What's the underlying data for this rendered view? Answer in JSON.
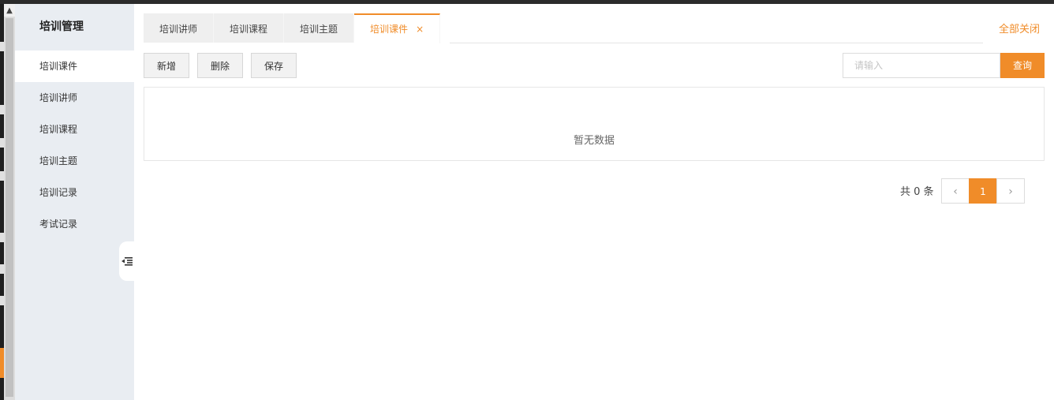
{
  "sidebar": {
    "title": "培训管理",
    "items": [
      {
        "label": "培训课件",
        "active": true
      },
      {
        "label": "培训讲师",
        "active": false
      },
      {
        "label": "培训课程",
        "active": false
      },
      {
        "label": "培训主题",
        "active": false
      },
      {
        "label": "培训记录",
        "active": false
      },
      {
        "label": "考试记录",
        "active": false
      }
    ],
    "collapse_icon": "collapse-left-icon"
  },
  "tabs": {
    "items": [
      {
        "label": "培训讲师"
      },
      {
        "label": "培训课程"
      },
      {
        "label": "培训主题"
      },
      {
        "label": "培训课件",
        "active": true,
        "close": "×"
      }
    ],
    "close_all": "全部关闭"
  },
  "toolbar": {
    "add_label": "新增",
    "delete_label": "删除",
    "save_label": "保存"
  },
  "search": {
    "placeholder": "请输入",
    "value": "",
    "button_label": "查询"
  },
  "table": {
    "empty_text": "暂无数据"
  },
  "pagination": {
    "total_text": "共 0 条",
    "prev_icon": "‹",
    "next_icon": "›",
    "current_page": "1"
  },
  "colors": {
    "accent": "#f08c29",
    "sidebar_bg": "#e9edf2"
  }
}
